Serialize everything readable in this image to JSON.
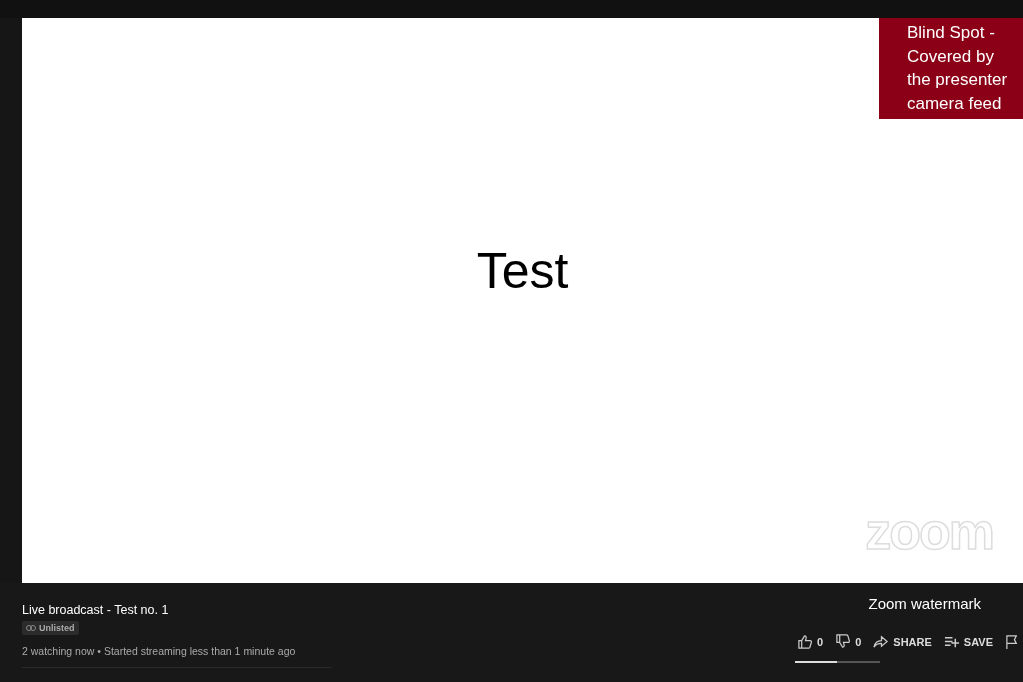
{
  "slide": {
    "title": "Test",
    "logo": "zoom"
  },
  "callout": {
    "text": "Blind Spot - Covered by the presenter camera feed"
  },
  "video": {
    "title": "Live broadcast - Test no. 1",
    "badge": "Unlisted",
    "meta": "2 watching now • Started streaming less than 1 minute ago"
  },
  "annotation": {
    "text": "Zoom watermark"
  },
  "actions": [
    {
      "kind": "like",
      "label": "0"
    },
    {
      "kind": "dislike",
      "label": "0"
    },
    {
      "kind": "share",
      "label": "SHARE"
    },
    {
      "kind": "save",
      "label": "SAVE"
    },
    {
      "kind": "flag"
    }
  ],
  "sentiment": {
    "level": 0.49
  }
}
